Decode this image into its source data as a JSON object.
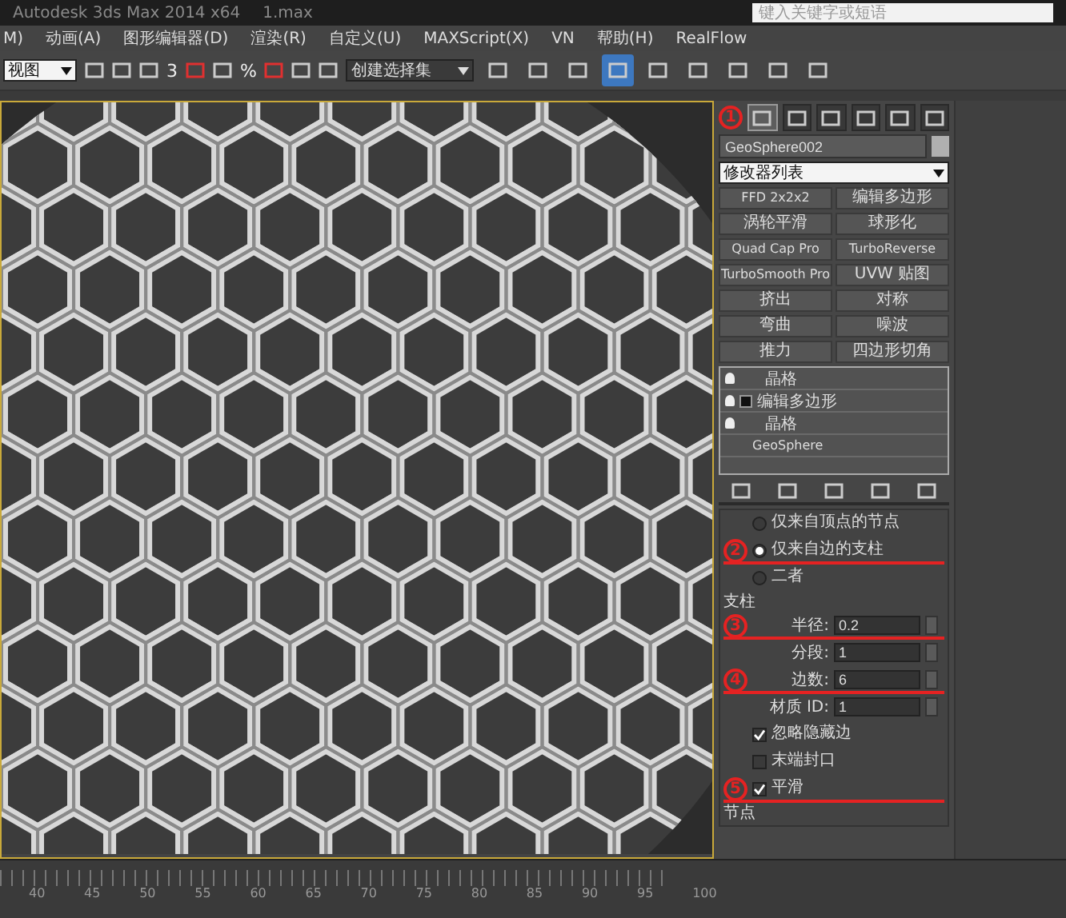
{
  "window": {
    "title": "Autodesk 3ds Max 2014 x64",
    "file": "1.max",
    "search": {
      "placeholder": "键入关键字或短语"
    }
  },
  "menu": [
    "M)",
    "动画(A)",
    "图形编辑器(D)",
    "渲染(R)",
    "自定义(U)",
    "MAXScript(X)",
    "VN",
    "帮助(H)",
    "RealFlow"
  ],
  "toolbar": {
    "view": "视图",
    "snap_angle": "3",
    "snap_percent": "%",
    "selection_set": "创建选择集",
    "tools": [
      {
        "selected": false
      },
      {
        "selected": false
      },
      {
        "selected": false
      },
      {
        "selected": true
      },
      {
        "selected": false
      },
      {
        "selected": false
      },
      {
        "selected": false
      },
      {
        "selected": false
      },
      {
        "selected": false
      }
    ]
  },
  "command_panel": {
    "tabs": [
      {
        "selected": true,
        "annotation": "1"
      },
      {
        "selected": false
      },
      {
        "selected": false
      },
      {
        "selected": false
      },
      {
        "selected": false
      },
      {
        "selected": false
      }
    ],
    "object_name": "GeoSphere002",
    "modifier_list": "修改器列表",
    "modifier_buttons": [
      "FFD 2x2x2",
      "编辑多边形",
      "涡轮平滑",
      "球形化",
      "Quad Cap Pro",
      "TurboReverse",
      "TurboSmooth Pro",
      "UVW 贴图",
      "挤出",
      "对称",
      "弯曲",
      "噪波",
      "推力",
      "四边形切角"
    ],
    "stack": [
      {
        "label": "晶格",
        "on": true,
        "expandable": false
      },
      {
        "label": "编辑多边形",
        "on": true,
        "expandable": true
      },
      {
        "label": "晶格",
        "on": true,
        "expandable": false
      },
      {
        "label": "GeoSphere",
        "on": false,
        "expandable": false
      }
    ],
    "geometry": [
      {
        "label": "仅来自顶点的节点",
        "selected": false
      },
      {
        "label": "仅来自边的支柱",
        "selected": true,
        "annotation": "2"
      },
      {
        "label": "二者",
        "selected": false
      }
    ],
    "struts": {
      "title": "支柱",
      "fields": [
        {
          "label": "半径:",
          "value": "0.2",
          "annotation": "3"
        },
        {
          "label": "分段:",
          "value": "1"
        },
        {
          "label": "边数:",
          "value": "6",
          "annotation": "4"
        },
        {
          "label": "材质 ID:",
          "value": "1"
        }
      ]
    },
    "options": [
      {
        "label": "忽略隐藏边",
        "checked": true
      },
      {
        "label": "末端封口",
        "checked": false
      },
      {
        "label": "平滑",
        "checked": true,
        "annotation": "5"
      }
    ],
    "joints_title": "节点"
  },
  "timeline": {
    "labels": [
      "40",
      "45",
      "50",
      "55",
      "60",
      "65",
      "70",
      "75",
      "80",
      "85",
      "90",
      "95",
      "100"
    ]
  }
}
